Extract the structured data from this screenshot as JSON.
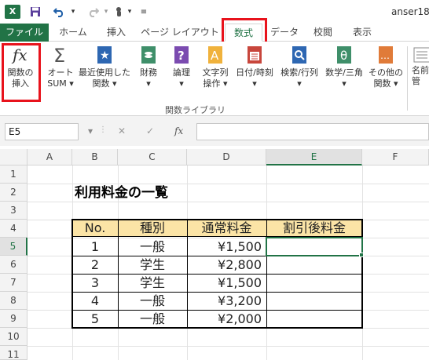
{
  "titlebar": {
    "app_icon": "X",
    "doc_title": "anser18"
  },
  "tabs": [
    {
      "label": "ファイル"
    },
    {
      "label": "ホーム"
    },
    {
      "label": "挿入"
    },
    {
      "label": "ページ レイアウト"
    },
    {
      "label": "数式"
    },
    {
      "label": "データ"
    },
    {
      "label": "校閲"
    },
    {
      "label": "表示"
    }
  ],
  "ribbon": {
    "buttons": [
      {
        "label1": "関数の",
        "label2": "挿入",
        "icon": "fx-icon"
      },
      {
        "label1": "オート",
        "label2": "SUM ▾",
        "icon": "sigma-icon"
      },
      {
        "label1": "最近使用した",
        "label2": "関数 ▾",
        "icon": "star-book-icon"
      },
      {
        "label1": "財務",
        "label2": "▾",
        "icon": "finance-book-icon"
      },
      {
        "label1": "論理",
        "label2": "▾",
        "icon": "question-book-icon"
      },
      {
        "label1": "文字列",
        "label2": "操作 ▾",
        "icon": "text-book-icon"
      },
      {
        "label1": "日付/時刻",
        "label2": "▾",
        "icon": "calendar-book-icon"
      },
      {
        "label1": "検索/行列",
        "label2": "▾",
        "icon": "search-book-icon"
      },
      {
        "label1": "数学/三角",
        "label2": "▾",
        "icon": "theta-book-icon"
      },
      {
        "label1": "その他の",
        "label2": "関数 ▾",
        "icon": "more-book-icon"
      },
      {
        "label1": "名前",
        "label2": "管",
        "icon": "name-manager-icon"
      }
    ],
    "group_label": "関数ライブラリ"
  },
  "formula_bar": {
    "name_box": "E5",
    "cancel": "✕",
    "enter": "✓",
    "fx": "fx",
    "value": ""
  },
  "columns": [
    "A",
    "B",
    "C",
    "D",
    "E",
    "F"
  ],
  "rows": [
    "1",
    "2",
    "3",
    "4",
    "5",
    "6",
    "7",
    "8",
    "9",
    "10",
    "11"
  ],
  "selected_cell": {
    "col": "E",
    "row": "5"
  },
  "sheet": {
    "title": "利用料金の一覧",
    "headers": [
      "No.",
      "種別",
      "通常料金",
      "割引後料金"
    ],
    "rows": [
      {
        "no": "1",
        "type": "一般",
        "price": "¥1,500",
        "discount": ""
      },
      {
        "no": "2",
        "type": "学生",
        "price": "¥2,800",
        "discount": ""
      },
      {
        "no": "3",
        "type": "学生",
        "price": "¥1,500",
        "discount": ""
      },
      {
        "no": "4",
        "type": "一般",
        "price": "¥3,200",
        "discount": ""
      },
      {
        "no": "5",
        "type": "一般",
        "price": "¥2,000",
        "discount": ""
      }
    ]
  },
  "colors": {
    "excel_green": "#217346",
    "highlight_red": "#e8131c",
    "header_fill": "#fbe4a6"
  }
}
